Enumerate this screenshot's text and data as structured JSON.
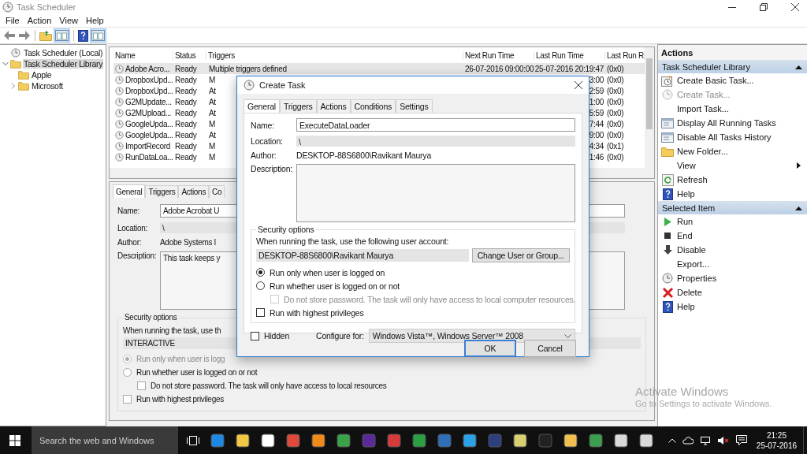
{
  "window": {
    "title": "Task Scheduler",
    "menu": [
      "File",
      "Action",
      "View",
      "Help"
    ]
  },
  "tree": [
    {
      "label": "Task Scheduler (Local)",
      "selected": false,
      "children": [
        {
          "label": "Task Scheduler Library",
          "selected": true,
          "expanded": true,
          "children": [
            {
              "label": "Apple",
              "selected": false
            },
            {
              "label": "Microsoft",
              "selected": false,
              "expanded": false
            }
          ]
        }
      ]
    }
  ],
  "table": {
    "columns": [
      "Name",
      "Status",
      "Triggers",
      "Next Run Time",
      "Last Run Time",
      "Last Run R"
    ],
    "rows": [
      {
        "name": "Adobe Acro...",
        "status": "Ready",
        "triggers": "Multiple triggers defined",
        "next_run": "26-07-2016 09:00:00",
        "last_run": "25-07-2016 20:19:47",
        "result": "(0x0)",
        "selected": true
      },
      {
        "name": "DropboxUpd...",
        "status": "Ready",
        "triggers": "M",
        "last_run": "3:00",
        "result": "(0x0)",
        "selected": false
      },
      {
        "name": "DropboxUpd...",
        "status": "Ready",
        "triggers": "At",
        "last_run": "2:59",
        "result": "(0x0)",
        "selected": false
      },
      {
        "name": "G2MUpdate...",
        "status": "Ready",
        "triggers": "At",
        "last_run": "1:00",
        "result": "(0x0)",
        "selected": false
      },
      {
        "name": "G2MUpload...",
        "status": "Ready",
        "triggers": "At",
        "last_run": "5:59",
        "result": "(0x0)",
        "selected": false
      },
      {
        "name": "GoogleUpda...",
        "status": "Ready",
        "triggers": "M",
        "last_run": "7:44",
        "result": "(0x0)",
        "selected": false
      },
      {
        "name": "GoogleUpda...",
        "status": "Ready",
        "triggers": "At",
        "last_run": "9:00",
        "result": "(0x0)",
        "selected": false
      },
      {
        "name": "ImportRecord",
        "status": "Ready",
        "triggers": "M",
        "last_run": "4:34",
        "result": "(0x1)",
        "selected": false
      },
      {
        "name": "RunDataLoa...",
        "status": "Ready",
        "triggers": "M",
        "last_run": "1:46",
        "result": "(0x0)",
        "selected": false
      }
    ]
  },
  "details": {
    "tabs": [
      {
        "label": "General",
        "selected": true
      },
      {
        "label": "Triggers",
        "selected": false
      },
      {
        "label": "Actions",
        "selected": false
      },
      {
        "label": "Co",
        "selected": false
      }
    ],
    "fields": [
      {
        "label": "Name:",
        "value": "Adobe Acrobat U",
        "kind": "input"
      },
      {
        "label": "Location:",
        "value": "\\",
        "kind": "readonly"
      },
      {
        "label": "Author:",
        "value": "Adobe Systems I",
        "kind": "text"
      },
      {
        "label": "Description:",
        "value": "This task keeps y",
        "kind": "textarea"
      }
    ],
    "security": {
      "title": "Security options",
      "prompt": "When running the task, use th",
      "account": "INTERACTIVE",
      "options": [
        {
          "kind": "radio",
          "label": "Run only when user is logg",
          "selected": true,
          "disabled": true
        },
        {
          "kind": "radio",
          "label": "Run whether user is logged on or not",
          "selected": false,
          "disabled": false,
          "children": [
            {
              "kind": "checkbox",
              "label": "Do not store password.  The task will only have access to local resources",
              "checked": false,
              "disabled": false
            }
          ]
        },
        {
          "kind": "checkbox",
          "label": "Run with highest privileges",
          "checked": false,
          "disabled": false
        }
      ]
    }
  },
  "actions": {
    "title": "Actions",
    "sections": [
      {
        "title": "Task Scheduler Library",
        "expanded": true,
        "items": [
          {
            "label": "Create Basic Task...",
            "disabled": false,
            "submenu": false
          },
          {
            "label": "Create Task...",
            "disabled": true,
            "submenu": false
          },
          {
            "label": "Import Task...",
            "disabled": false,
            "submenu": false
          },
          {
            "label": "Display All Running Tasks",
            "disabled": false,
            "submenu": false
          },
          {
            "label": "Disable All Tasks History",
            "disabled": false,
            "submenu": false
          },
          {
            "label": "New Folder...",
            "disabled": false,
            "submenu": false
          },
          {
            "label": "View",
            "disabled": false,
            "submenu": true
          },
          {
            "label": "Refresh",
            "disabled": false,
            "submenu": false
          },
          {
            "label": "Help",
            "disabled": false,
            "submenu": false
          }
        ]
      },
      {
        "title": "Selected Item",
        "expanded": true,
        "items": [
          {
            "label": "Run",
            "disabled": false,
            "submenu": false
          },
          {
            "label": "End",
            "disabled": false,
            "submenu": false
          },
          {
            "label": "Disable",
            "disabled": false,
            "submenu": false
          },
          {
            "label": "Export...",
            "disabled": false,
            "submenu": false
          },
          {
            "label": "Properties",
            "disabled": false,
            "submenu": false
          },
          {
            "label": "Delete",
            "disabled": false,
            "submenu": false
          },
          {
            "label": "Help",
            "disabled": false,
            "submenu": false
          }
        ]
      }
    ]
  },
  "dialog": {
    "title": "Create Task",
    "tabs": [
      {
        "label": "General",
        "selected": true
      },
      {
        "label": "Triggers",
        "selected": false
      },
      {
        "label": "Actions",
        "selected": false
      },
      {
        "label": "Conditions",
        "selected": false
      },
      {
        "label": "Settings",
        "selected": false
      }
    ],
    "fields": [
      {
        "label": "Name:",
        "value": "ExecuteDataLoader",
        "kind": "input"
      },
      {
        "label": "Location:",
        "value": "\\",
        "kind": "readonly"
      },
      {
        "label": "Author:",
        "value": "DESKTOP-88S6800\\Ravikant Maurya",
        "kind": "text"
      },
      {
        "label": "Description:",
        "kind": "textarea"
      }
    ],
    "security": {
      "title": "Security options",
      "prompt": "When running the task, use the following user account:",
      "account": "DESKTOP-88S6800\\Ravikant Maurya",
      "change_button": "Change User or Group...",
      "options": [
        {
          "kind": "radio",
          "label": "Run only when user is logged on",
          "selected": true,
          "disabled": false
        },
        {
          "kind": "radio",
          "label": "Run whether user is logged on or not",
          "selected": false,
          "disabled": false,
          "children": [
            {
              "kind": "checkbox",
              "label": "Do not store password.  The task will only have access to local computer resources.",
              "checked": false,
              "disabled": true
            }
          ]
        },
        {
          "kind": "checkbox",
          "label": "Run with highest privileges",
          "checked": false,
          "disabled": false
        }
      ]
    },
    "hidden": {
      "label": "Hidden",
      "checked": false
    },
    "configure": {
      "label": "Configure for:",
      "value": "Windows Vista™, Windows Server™ 2008"
    },
    "buttons": [
      {
        "label": "OK",
        "default": true
      },
      {
        "label": "Cancel",
        "default": false
      }
    ]
  },
  "taskbar": {
    "search_placeholder": "Search the web and Windows",
    "time": "21:25",
    "date": "25-07-2016"
  },
  "system_notice": {
    "title": "Activate Windows",
    "text": "Go to Settings to activate Windows."
  }
}
